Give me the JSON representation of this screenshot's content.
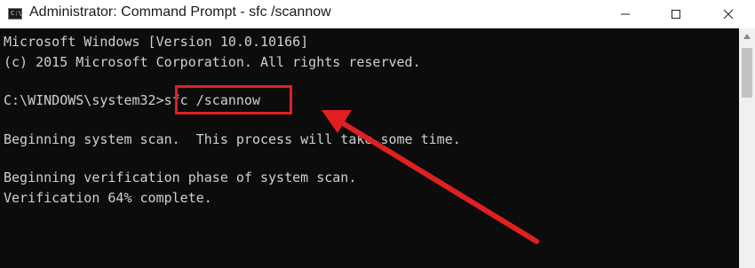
{
  "window": {
    "title": "Administrator: Command Prompt - sfc  /scannow",
    "icon_prompt": "C:\\"
  },
  "controls": {
    "minimize": "minimize-icon",
    "maximize": "maximize-icon",
    "close": "close-icon"
  },
  "console": {
    "lines": [
      "Microsoft Windows [Version 10.0.10166]",
      "(c) 2015 Microsoft Corporation. All rights reserved.",
      "",
      "C:\\WINDOWS\\system32>sfc /scannow",
      "",
      "Beginning system scan.  This process will take some time.",
      "",
      "Beginning verification phase of system scan.",
      "Verification 64% complete."
    ]
  },
  "annotation": {
    "highlight_color": "#e02020",
    "arrow_color": "#e02020"
  }
}
